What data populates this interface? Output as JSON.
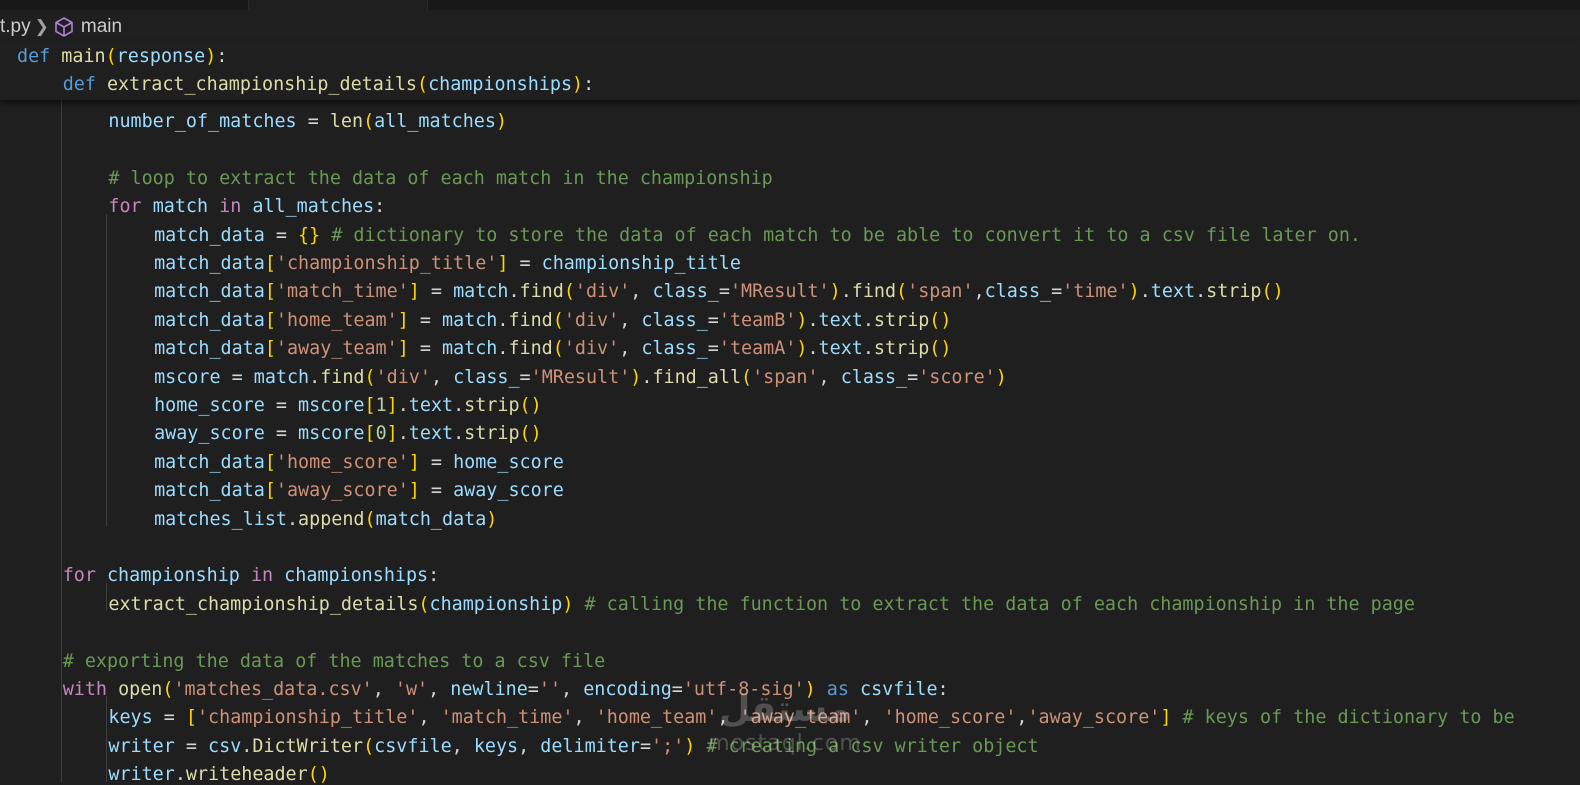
{
  "breadcrumb": {
    "file": "t.py",
    "symbol": "main"
  },
  "sticky_lines": [
    [
      [
        "kw",
        "def"
      ],
      [
        "pn",
        " "
      ],
      [
        "fn",
        "main"
      ],
      [
        "b1",
        "("
      ],
      [
        "var",
        "response"
      ],
      [
        "b1",
        ")"
      ],
      [
        "pn",
        ":"
      ]
    ],
    [
      [
        "kw",
        "def"
      ],
      [
        "pn",
        " "
      ],
      [
        "fn",
        "extract_championship_details"
      ],
      [
        "b1",
        "("
      ],
      [
        "var",
        "championships"
      ],
      [
        "b1",
        ")"
      ],
      [
        "pn",
        ":"
      ]
    ]
  ],
  "code_lines": [
    [
      [
        "var",
        "number_of_matches"
      ],
      [
        "pn",
        " = "
      ],
      [
        "fn",
        "len"
      ],
      [
        "b1",
        "("
      ],
      [
        "var",
        "all_matches"
      ],
      [
        "b1",
        ")"
      ]
    ],
    [],
    [
      [
        "cm",
        "# loop to extract the data of each match in the championship"
      ]
    ],
    [
      [
        "ctl",
        "for"
      ],
      [
        "pn",
        " "
      ],
      [
        "var",
        "match"
      ],
      [
        "pn",
        " "
      ],
      [
        "ctl",
        "in"
      ],
      [
        "pn",
        " "
      ],
      [
        "var",
        "all_matches"
      ],
      [
        "pn",
        ":"
      ]
    ],
    [
      [
        "var",
        "match_data"
      ],
      [
        "pn",
        " = "
      ],
      [
        "b1",
        "{}"
      ],
      [
        "pn",
        " "
      ],
      [
        "cm",
        "# dictionary to store the data of each match to be able to convert it to a csv file later on."
      ]
    ],
    [
      [
        "var",
        "match_data"
      ],
      [
        "b1",
        "["
      ],
      [
        "str",
        "'championship_title'"
      ],
      [
        "b1",
        "]"
      ],
      [
        "pn",
        " = "
      ],
      [
        "var",
        "championship_title"
      ]
    ],
    [
      [
        "var",
        "match_data"
      ],
      [
        "b1",
        "["
      ],
      [
        "str",
        "'match_time'"
      ],
      [
        "b1",
        "]"
      ],
      [
        "pn",
        " = "
      ],
      [
        "var",
        "match"
      ],
      [
        "pn",
        "."
      ],
      [
        "fn",
        "find"
      ],
      [
        "b1",
        "("
      ],
      [
        "str",
        "'div'"
      ],
      [
        "pn",
        ", "
      ],
      [
        "var",
        "class_"
      ],
      [
        "pn",
        "="
      ],
      [
        "str",
        "'MResult'"
      ],
      [
        "b1",
        ")"
      ],
      [
        "pn",
        "."
      ],
      [
        "fn",
        "find"
      ],
      [
        "b1",
        "("
      ],
      [
        "str",
        "'span'"
      ],
      [
        "pn",
        ","
      ],
      [
        "var",
        "class_"
      ],
      [
        "pn",
        "="
      ],
      [
        "str",
        "'time'"
      ],
      [
        "b1",
        ")"
      ],
      [
        "pn",
        "."
      ],
      [
        "var",
        "text"
      ],
      [
        "pn",
        "."
      ],
      [
        "fn",
        "strip"
      ],
      [
        "b1",
        "()"
      ]
    ],
    [
      [
        "var",
        "match_data"
      ],
      [
        "b1",
        "["
      ],
      [
        "str",
        "'home_team'"
      ],
      [
        "b1",
        "]"
      ],
      [
        "pn",
        " = "
      ],
      [
        "var",
        "match"
      ],
      [
        "pn",
        "."
      ],
      [
        "fn",
        "find"
      ],
      [
        "b1",
        "("
      ],
      [
        "str",
        "'div'"
      ],
      [
        "pn",
        ", "
      ],
      [
        "var",
        "class_"
      ],
      [
        "pn",
        "="
      ],
      [
        "str",
        "'teamB'"
      ],
      [
        "b1",
        ")"
      ],
      [
        "pn",
        "."
      ],
      [
        "var",
        "text"
      ],
      [
        "pn",
        "."
      ],
      [
        "fn",
        "strip"
      ],
      [
        "b1",
        "()"
      ]
    ],
    [
      [
        "var",
        "match_data"
      ],
      [
        "b1",
        "["
      ],
      [
        "str",
        "'away_team'"
      ],
      [
        "b1",
        "]"
      ],
      [
        "pn",
        " = "
      ],
      [
        "var",
        "match"
      ],
      [
        "pn",
        "."
      ],
      [
        "fn",
        "find"
      ],
      [
        "b1",
        "("
      ],
      [
        "str",
        "'div'"
      ],
      [
        "pn",
        ", "
      ],
      [
        "var",
        "class_"
      ],
      [
        "pn",
        "="
      ],
      [
        "str",
        "'teamA'"
      ],
      [
        "b1",
        ")"
      ],
      [
        "pn",
        "."
      ],
      [
        "var",
        "text"
      ],
      [
        "pn",
        "."
      ],
      [
        "fn",
        "strip"
      ],
      [
        "b1",
        "()"
      ]
    ],
    [
      [
        "var",
        "mscore"
      ],
      [
        "pn",
        " = "
      ],
      [
        "var",
        "match"
      ],
      [
        "pn",
        "."
      ],
      [
        "fn",
        "find"
      ],
      [
        "b1",
        "("
      ],
      [
        "str",
        "'div'"
      ],
      [
        "pn",
        ", "
      ],
      [
        "var",
        "class_"
      ],
      [
        "pn",
        "="
      ],
      [
        "str",
        "'MResult'"
      ],
      [
        "b1",
        ")"
      ],
      [
        "pn",
        "."
      ],
      [
        "fn",
        "find_all"
      ],
      [
        "b1",
        "("
      ],
      [
        "str",
        "'span'"
      ],
      [
        "pn",
        ", "
      ],
      [
        "var",
        "class_"
      ],
      [
        "pn",
        "="
      ],
      [
        "str",
        "'score'"
      ],
      [
        "b1",
        ")"
      ]
    ],
    [
      [
        "var",
        "home_score"
      ],
      [
        "pn",
        " = "
      ],
      [
        "var",
        "mscore"
      ],
      [
        "b1",
        "["
      ],
      [
        "num",
        "1"
      ],
      [
        "b1",
        "]"
      ],
      [
        "pn",
        "."
      ],
      [
        "var",
        "text"
      ],
      [
        "pn",
        "."
      ],
      [
        "fn",
        "strip"
      ],
      [
        "b1",
        "()"
      ]
    ],
    [
      [
        "var",
        "away_score"
      ],
      [
        "pn",
        " = "
      ],
      [
        "var",
        "mscore"
      ],
      [
        "b1",
        "["
      ],
      [
        "num",
        "0"
      ],
      [
        "b1",
        "]"
      ],
      [
        "pn",
        "."
      ],
      [
        "var",
        "text"
      ],
      [
        "pn",
        "."
      ],
      [
        "fn",
        "strip"
      ],
      [
        "b1",
        "()"
      ]
    ],
    [
      [
        "var",
        "match_data"
      ],
      [
        "b1",
        "["
      ],
      [
        "str",
        "'home_score'"
      ],
      [
        "b1",
        "]"
      ],
      [
        "pn",
        " = "
      ],
      [
        "var",
        "home_score"
      ]
    ],
    [
      [
        "var",
        "match_data"
      ],
      [
        "b1",
        "["
      ],
      [
        "str",
        "'away_score'"
      ],
      [
        "b1",
        "]"
      ],
      [
        "pn",
        " = "
      ],
      [
        "var",
        "away_score"
      ]
    ],
    [
      [
        "var",
        "matches_list"
      ],
      [
        "pn",
        "."
      ],
      [
        "fn",
        "append"
      ],
      [
        "b1",
        "("
      ],
      [
        "var",
        "match_data"
      ],
      [
        "b1",
        ")"
      ]
    ],
    [],
    [
      [
        "ctl",
        "for"
      ],
      [
        "pn",
        " "
      ],
      [
        "var",
        "championship"
      ],
      [
        "pn",
        " "
      ],
      [
        "ctl",
        "in"
      ],
      [
        "pn",
        " "
      ],
      [
        "var",
        "championships"
      ],
      [
        "pn",
        ":"
      ]
    ],
    [
      [
        "fn",
        "extract_championship_details"
      ],
      [
        "b1",
        "("
      ],
      [
        "var",
        "championship"
      ],
      [
        "b1",
        ")"
      ],
      [
        "pn",
        " "
      ],
      [
        "cm",
        "# calling the function to extract the data of each championship in the page"
      ]
    ],
    [],
    [
      [
        "cm",
        "# exporting the data of the matches to a csv file"
      ]
    ],
    [
      [
        "ctl",
        "with"
      ],
      [
        "pn",
        " "
      ],
      [
        "fn",
        "open"
      ],
      [
        "b1",
        "("
      ],
      [
        "str",
        "'matches_data.csv'"
      ],
      [
        "pn",
        ", "
      ],
      [
        "str",
        "'w'"
      ],
      [
        "pn",
        ", "
      ],
      [
        "var",
        "newline"
      ],
      [
        "pn",
        "="
      ],
      [
        "str",
        "''"
      ],
      [
        "pn",
        ", "
      ],
      [
        "var",
        "encoding"
      ],
      [
        "pn",
        "="
      ],
      [
        "str",
        "'utf-8-sig'"
      ],
      [
        "b1",
        ")"
      ],
      [
        "pn",
        " "
      ],
      [
        "kw",
        "as"
      ],
      [
        "pn",
        " "
      ],
      [
        "var",
        "csvfile"
      ],
      [
        "pn",
        ":"
      ]
    ],
    [
      [
        "var",
        "keys"
      ],
      [
        "pn",
        " = "
      ],
      [
        "b1",
        "["
      ],
      [
        "str",
        "'championship_title'"
      ],
      [
        "pn",
        ", "
      ],
      [
        "str",
        "'match_time'"
      ],
      [
        "pn",
        ", "
      ],
      [
        "str",
        "'home_team'"
      ],
      [
        "pn",
        ", "
      ],
      [
        "str",
        "'away_team'"
      ],
      [
        "pn",
        ", "
      ],
      [
        "str",
        "'home_score'"
      ],
      [
        "pn",
        ","
      ],
      [
        "str",
        "'away_score'"
      ],
      [
        "b1",
        "]"
      ],
      [
        "pn",
        " "
      ],
      [
        "cm",
        "# keys of the dictionary to be"
      ]
    ],
    [
      [
        "var",
        "writer"
      ],
      [
        "pn",
        " = "
      ],
      [
        "var",
        "csv"
      ],
      [
        "pn",
        "."
      ],
      [
        "fn",
        "DictWriter"
      ],
      [
        "b1",
        "("
      ],
      [
        "var",
        "csvfile"
      ],
      [
        "pn",
        ", "
      ],
      [
        "var",
        "keys"
      ],
      [
        "pn",
        ", "
      ],
      [
        "var",
        "delimiter"
      ],
      [
        "pn",
        "="
      ],
      [
        "str",
        "';'"
      ],
      [
        "b1",
        ")"
      ],
      [
        "pn",
        " "
      ],
      [
        "cm",
        "# creating a csv writer object"
      ]
    ],
    [
      [
        "var",
        "writer"
      ],
      [
        "pn",
        "."
      ],
      [
        "fn",
        "writeheader"
      ],
      [
        "b1",
        "()"
      ]
    ]
  ],
  "watermark": {
    "arabic": "مستقل",
    "latin": "mostaql.com"
  },
  "colors": {
    "background": "#1f1f1f",
    "keyword": "#569cd6",
    "control": "#c586c0",
    "function": "#dcdcaa",
    "variable": "#9cdcfe",
    "string": "#ce9178",
    "number": "#b5cea8",
    "comment": "#6a9955",
    "bracket": "#ffd700"
  }
}
